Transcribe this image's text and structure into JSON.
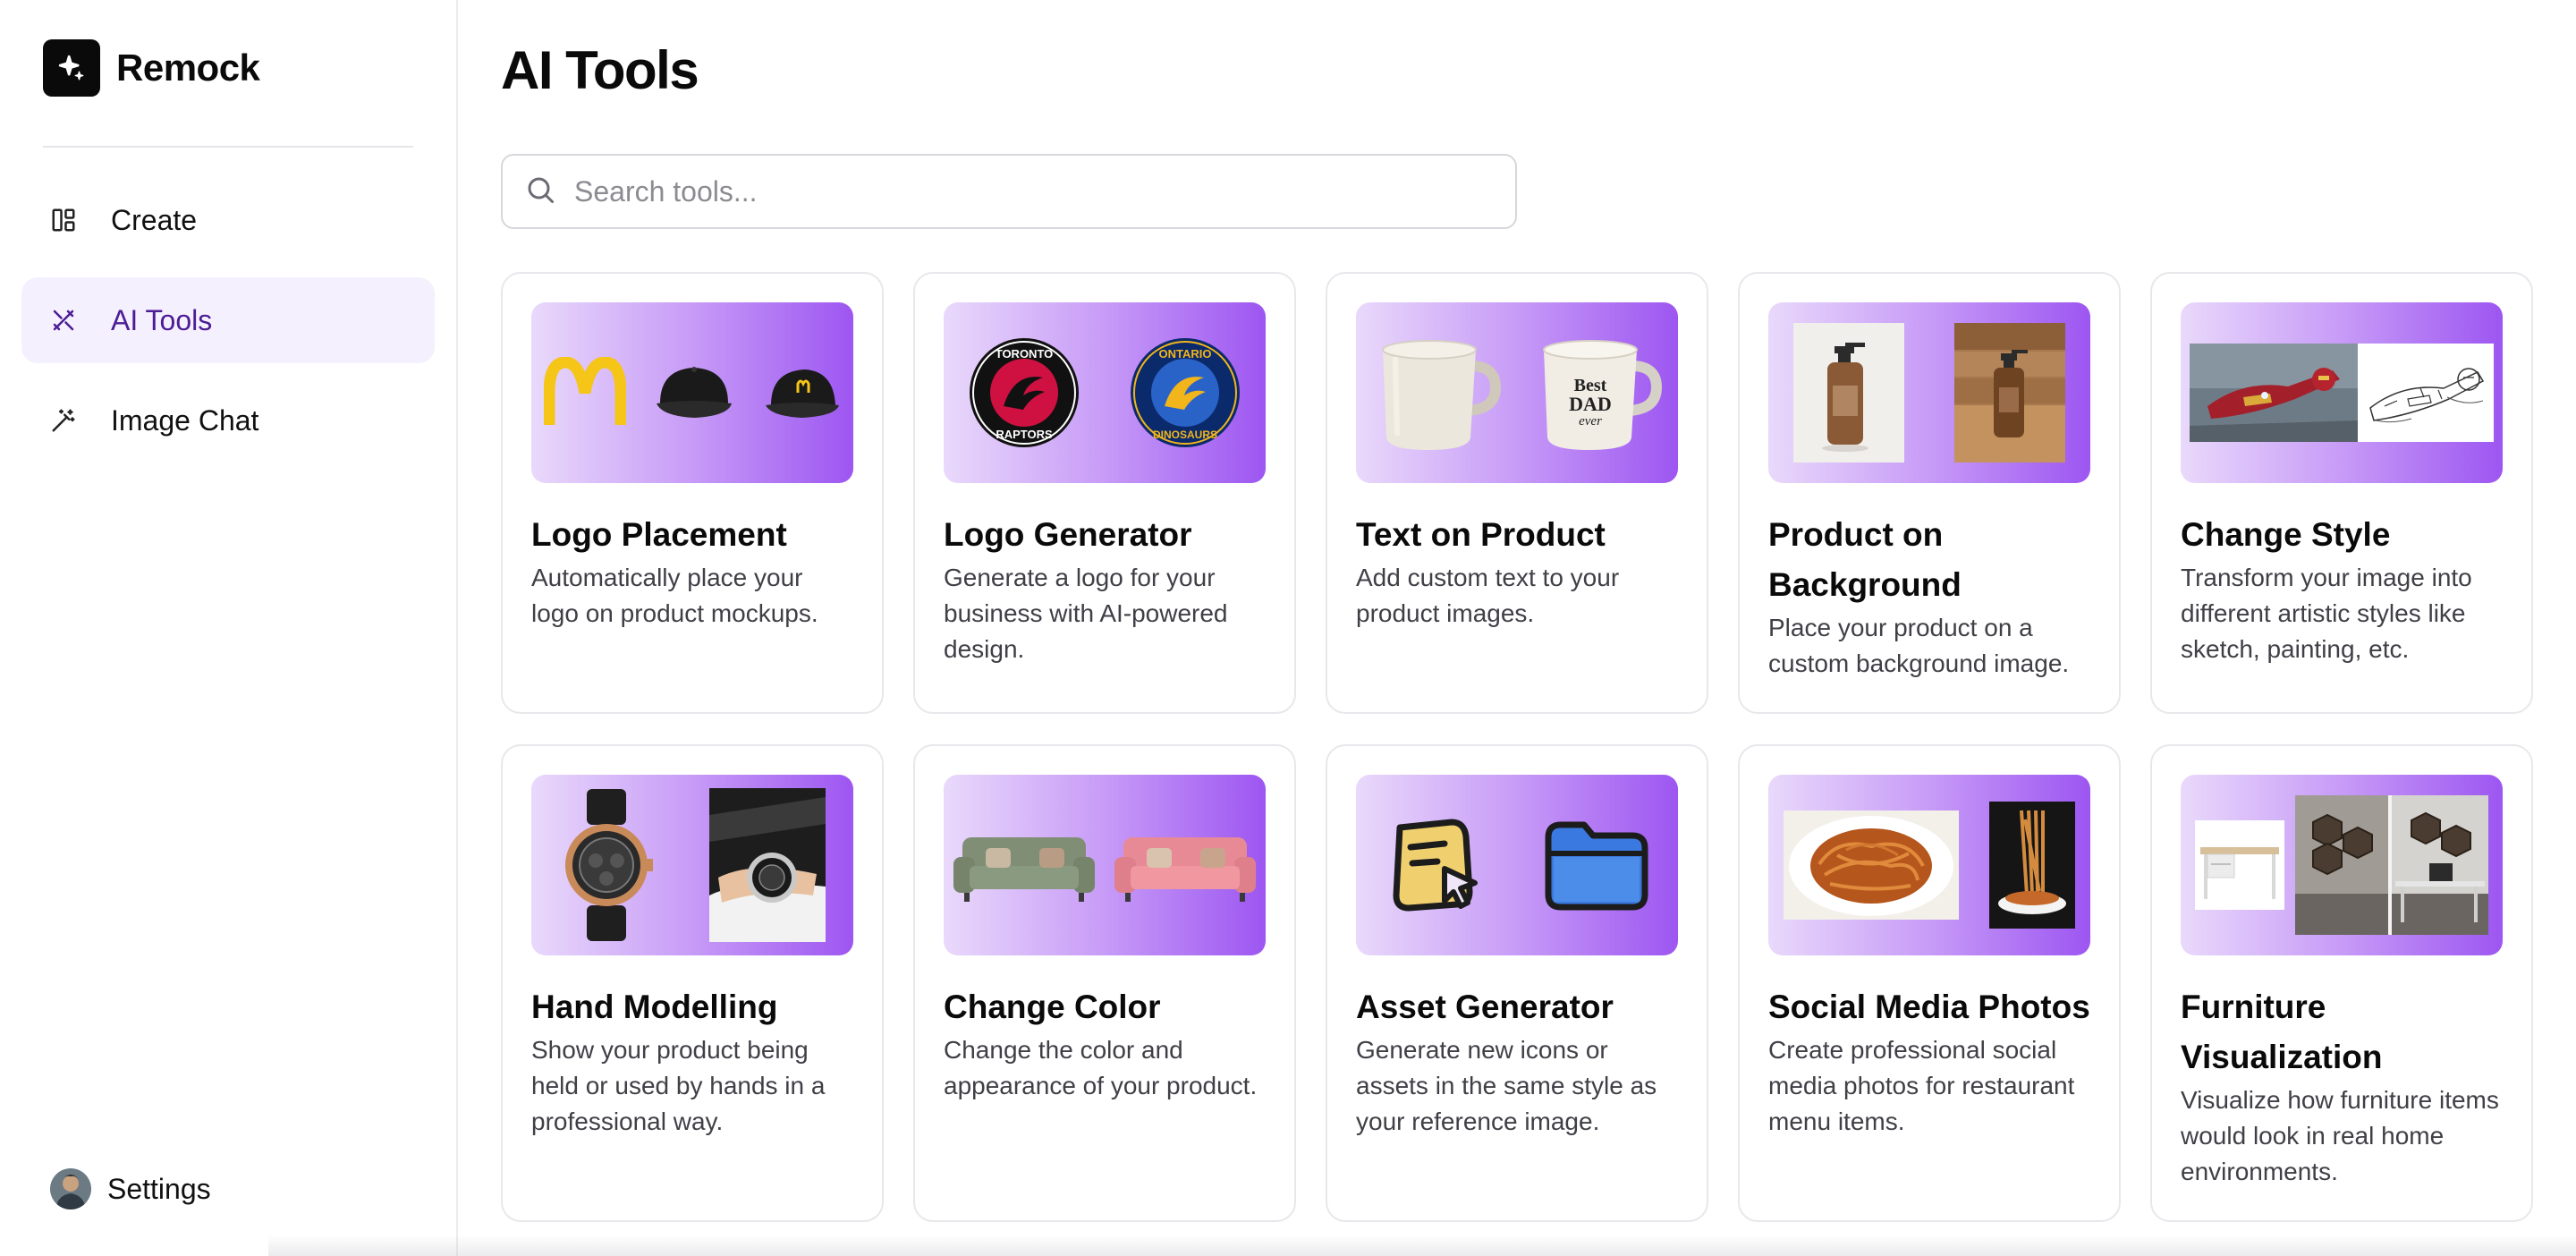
{
  "brand": {
    "name": "Remock"
  },
  "sidebar": {
    "items": [
      {
        "label": "Create",
        "icon": "layout-icon",
        "active": false
      },
      {
        "label": "AI Tools",
        "icon": "tools-icon",
        "active": true
      },
      {
        "label": "Image Chat",
        "icon": "magic-wand-icon",
        "active": false
      }
    ],
    "settings_label": "Settings"
  },
  "main": {
    "title": "AI Tools",
    "search": {
      "placeholder": "Search tools...",
      "value": ""
    }
  },
  "tools": [
    {
      "title": "Logo Placement",
      "description": "Automatically place your logo on product mockups."
    },
    {
      "title": "Logo Generator",
      "description": "Generate a logo for your business with AI-powered design."
    },
    {
      "title": "Text on Product",
      "description": "Add custom text to your product images."
    },
    {
      "title": "Product on Background",
      "description": "Place your product on a custom background image."
    },
    {
      "title": "Change Style",
      "description": "Transform your image into different artistic styles like sketch, painting, etc."
    },
    {
      "title": "Hand Modelling",
      "description": "Show your product being held or used by hands in a professional way."
    },
    {
      "title": "Change Color",
      "description": "Change the color and appearance of your product."
    },
    {
      "title": "Asset Generator",
      "description": "Generate new icons or assets in the same style as your reference image."
    },
    {
      "title": "Social Media Photos",
      "description": "Create professional social media photos for restaurant menu items."
    },
    {
      "title": "Furniture Visualization",
      "description": "Visualize how furniture items would look in real home environments."
    }
  ],
  "thumbnail_text": {
    "raptors_top": "TORONTO",
    "raptors_bottom": "RAPTORS",
    "dinosaurs_top": "ONTARIO",
    "dinosaurs_bottom": "DINOSAURS",
    "mug_line1": "Best",
    "mug_line2": "DAD",
    "mug_line3": "ever"
  },
  "colors": {
    "accent": "#4c1d95",
    "active_bg": "#f5f0fe",
    "thumb_gradient_start": "#e9d9fb",
    "thumb_gradient_end": "#9d56f1"
  }
}
